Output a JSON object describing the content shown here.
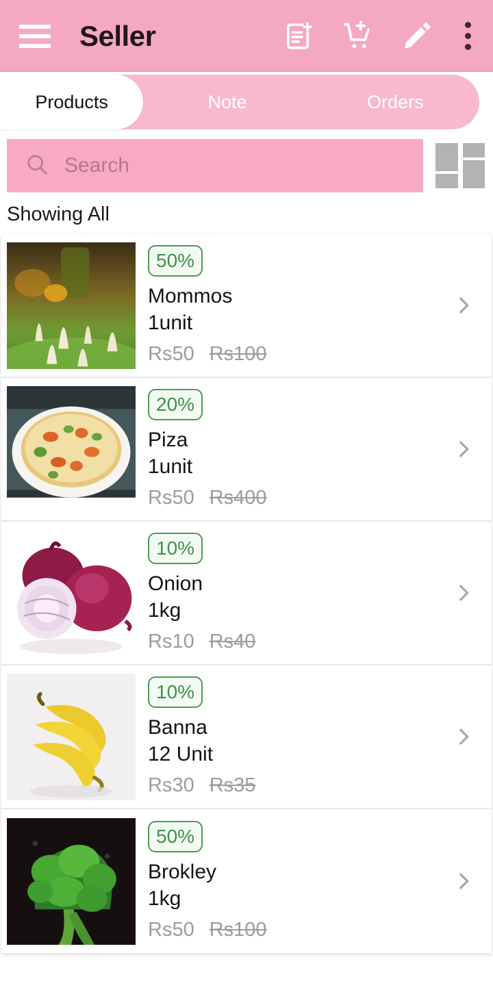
{
  "appbar": {
    "title": "Seller",
    "menu_icon": "hamburger-menu-icon",
    "actions": [
      {
        "icon": "note-add-icon",
        "label": "Add note"
      },
      {
        "icon": "add-shopping-cart-icon",
        "label": "Add to cart"
      },
      {
        "icon": "edit-pencil-icon",
        "label": "Edit"
      },
      {
        "icon": "more-vert-icon",
        "label": "More options"
      }
    ]
  },
  "tabs": [
    {
      "label": "Products",
      "active": true
    },
    {
      "label": "Note",
      "active": false
    },
    {
      "label": "Orders",
      "active": false
    }
  ],
  "search": {
    "value": "",
    "placeholder": "Search",
    "icon": "search-icon"
  },
  "view_toggle": {
    "icon": "grid-view-icon"
  },
  "filter_status": "Showing All",
  "colors": {
    "appbar_pink": "#f5a8c4",
    "tabbar_pink": "#f8b9d0",
    "search_pink": "#f7a9c6",
    "badge_green": "#3f9249",
    "badge_border": "#4d9a55",
    "price_grey": "#9c9c9c",
    "grid_icon_grey": "#b3b3b3"
  },
  "products": [
    {
      "name": "Mommos",
      "unit": "1unit",
      "discount": "50%",
      "price": "Rs50",
      "original_price": "Rs100",
      "image": "modak-sweets-photo"
    },
    {
      "name": "Piza",
      "unit": "1unit",
      "discount": "20%",
      "price": "Rs50",
      "original_price": "Rs400",
      "image": "pizza-photo"
    },
    {
      "name": "Onion",
      "unit": "1kg",
      "discount": "10%",
      "price": "Rs10",
      "original_price": "Rs40",
      "image": "red-onions-photo"
    },
    {
      "name": "Banna",
      "unit": "12 Unit",
      "discount": "10%",
      "price": "Rs30",
      "original_price": "Rs35",
      "image": "bananas-photo"
    },
    {
      "name": "Brokley",
      "unit": "1kg",
      "discount": "50%",
      "price": "Rs50",
      "original_price": "Rs100",
      "image": "broccoli-photo"
    }
  ]
}
